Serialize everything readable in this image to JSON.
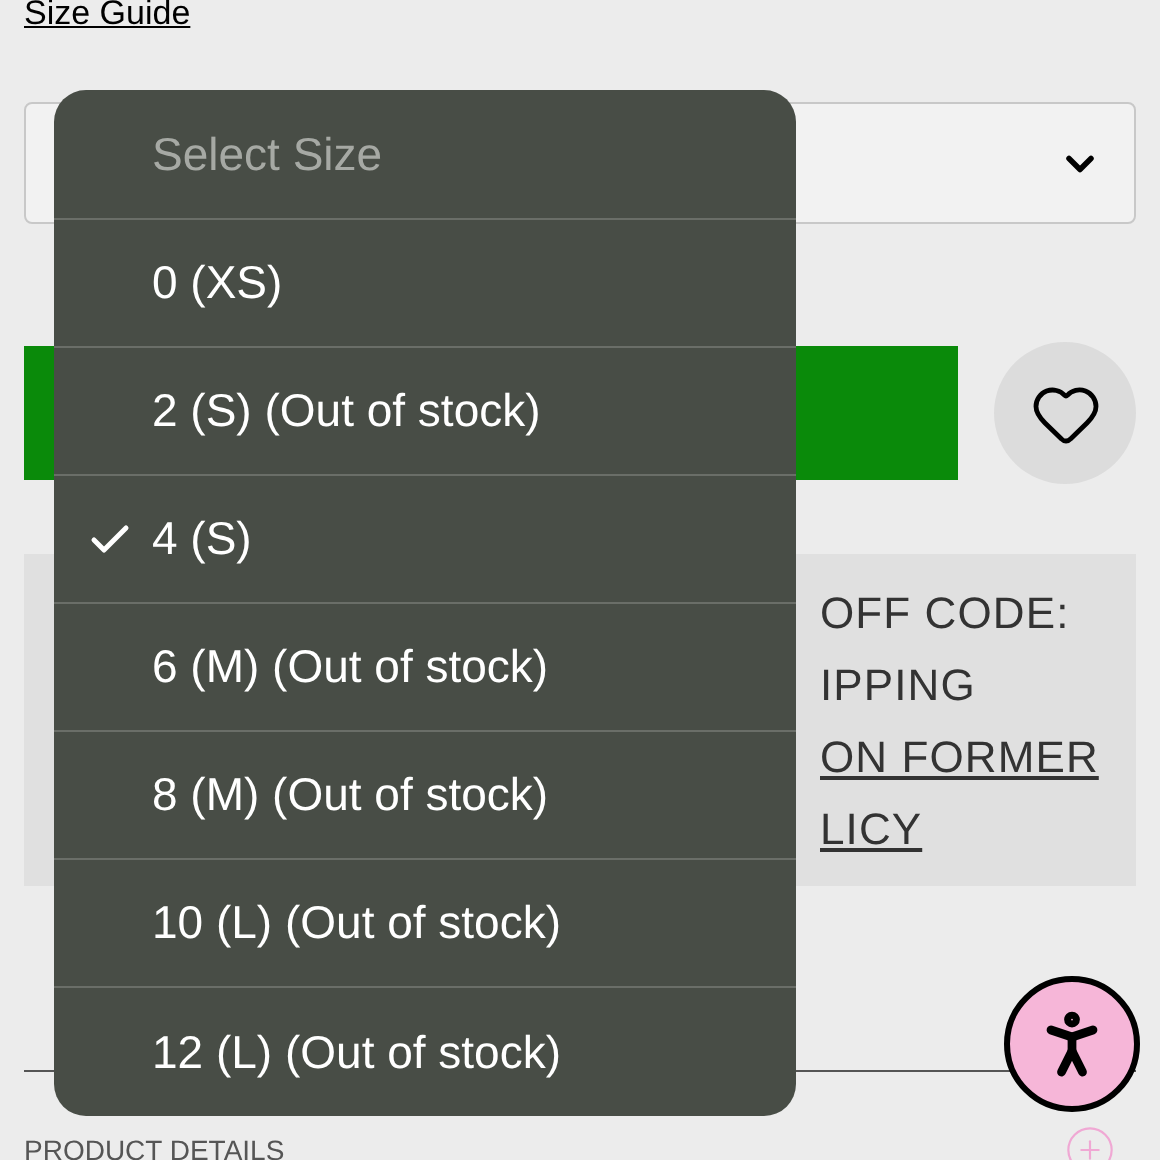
{
  "size_guide": "Size Guide",
  "promo": {
    "lines": [
      {
        "text": "OFF CODE:",
        "link": false
      },
      {
        "text": "IPPING",
        "link": false
      },
      {
        "text": "ON FORMER",
        "link": true
      },
      {
        "text": "LICY",
        "link": true
      }
    ]
  },
  "product_details": "PRODUCT DETAILS",
  "size_menu": {
    "header": "Select Size",
    "options": [
      {
        "label": "0 (XS)",
        "selected": false
      },
      {
        "label": "2 (S) (Out of stock)",
        "selected": false
      },
      {
        "label": "4 (S)",
        "selected": true
      },
      {
        "label": "6 (M) (Out of stock)",
        "selected": false
      },
      {
        "label": "8 (M) (Out of stock)",
        "selected": false
      },
      {
        "label": "10 (L) (Out of stock)",
        "selected": false
      },
      {
        "label": "12 (L) (Out of stock)",
        "selected": false
      }
    ]
  }
}
